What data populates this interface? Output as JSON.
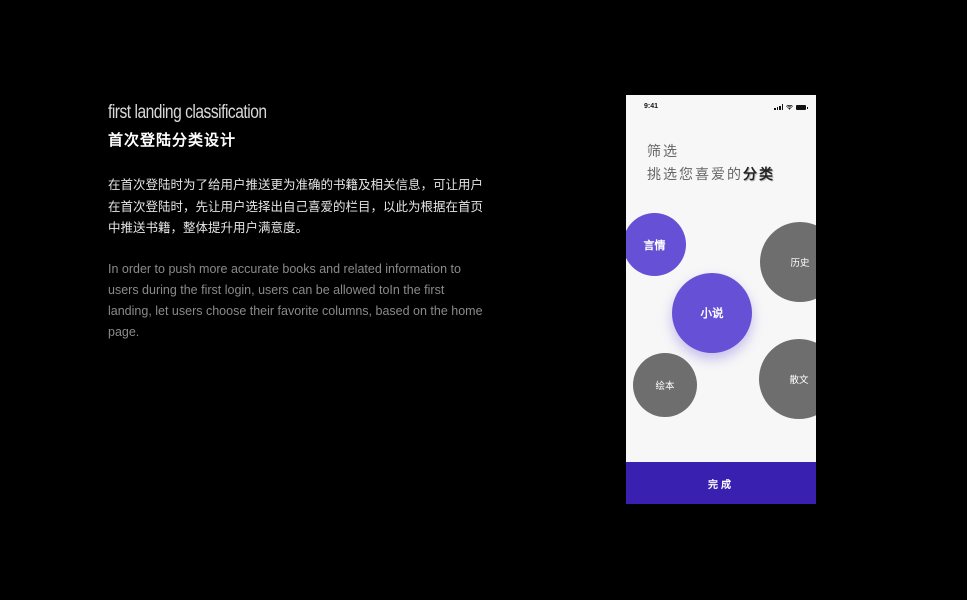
{
  "intro": {
    "title_en": "first landing classification",
    "title_cn": "首次登陆分类设计",
    "desc_cn": "在首次登陆时为了给用户推送更为准确的书籍及相关信息，可让用户在首次登陆时，先让用户选择出自己喜爱的栏目，以此为根据在首页中推送书籍，整体提升用户满意度。",
    "desc_en": "In order to push more accurate books and related information to users during the first login, users can be allowed toIn the first landing, let users choose their favorite columns, based on the home page."
  },
  "phone": {
    "status_time": "9:41",
    "heading_line1": "筛选",
    "heading_line2_prefix": "挑选您喜爱的",
    "heading_line2_emphasis": "分类",
    "categories": [
      {
        "label": "言情",
        "selected": true,
        "color": "#6650d6"
      },
      {
        "label": "小说",
        "selected": true,
        "color": "#6650d6"
      },
      {
        "label": "历史",
        "selected": false,
        "color": "#6e6e6e"
      },
      {
        "label": "绘本",
        "selected": false,
        "color": "#6e6e6e"
      },
      {
        "label": "散文",
        "selected": false,
        "color": "#6e6e6e"
      }
    ],
    "finish_label": "完成",
    "accent_color": "#3a20b0"
  }
}
